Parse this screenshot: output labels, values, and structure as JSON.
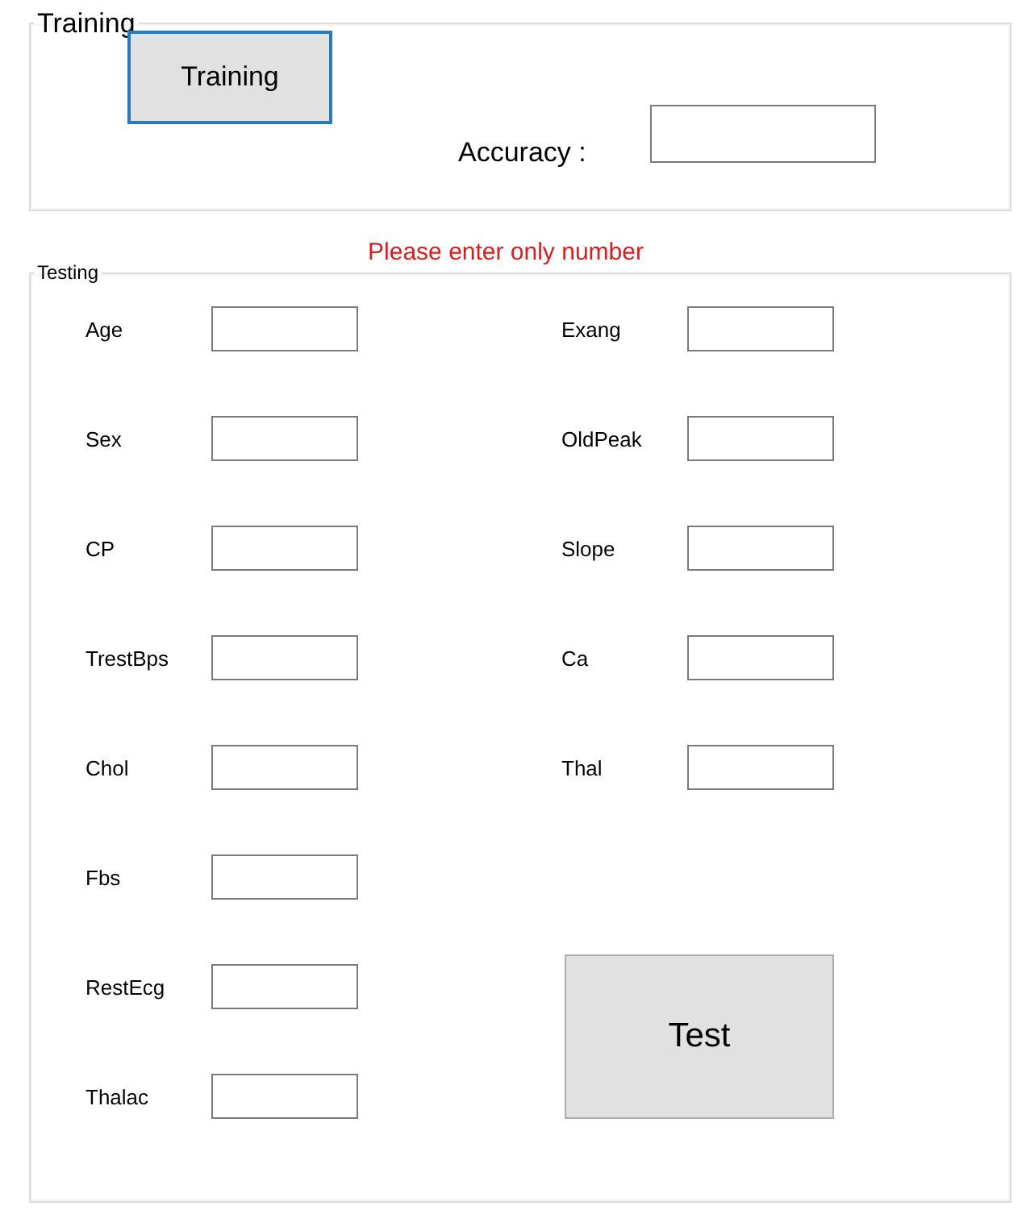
{
  "training": {
    "title": "Training",
    "train_button": {
      "label": "Training",
      "focused": true
    },
    "accuracy_label": "Accuracy :"
  },
  "error_message": "Please enter only number",
  "testing": {
    "title": "Testing",
    "left_fields": [
      {
        "label": "Age"
      },
      {
        "label": "Sex"
      },
      {
        "label": "CP"
      },
      {
        "label": "TrestBps"
      },
      {
        "label": "Chol"
      },
      {
        "label": "Fbs"
      },
      {
        "label": "RestEcg"
      },
      {
        "label": "Thalac"
      }
    ],
    "right_fields": [
      {
        "label": "Exang"
      },
      {
        "label": "OldPeak"
      },
      {
        "label": "Slope"
      },
      {
        "label": "Ca"
      },
      {
        "label": "Thal"
      }
    ],
    "test_button": "Test"
  }
}
